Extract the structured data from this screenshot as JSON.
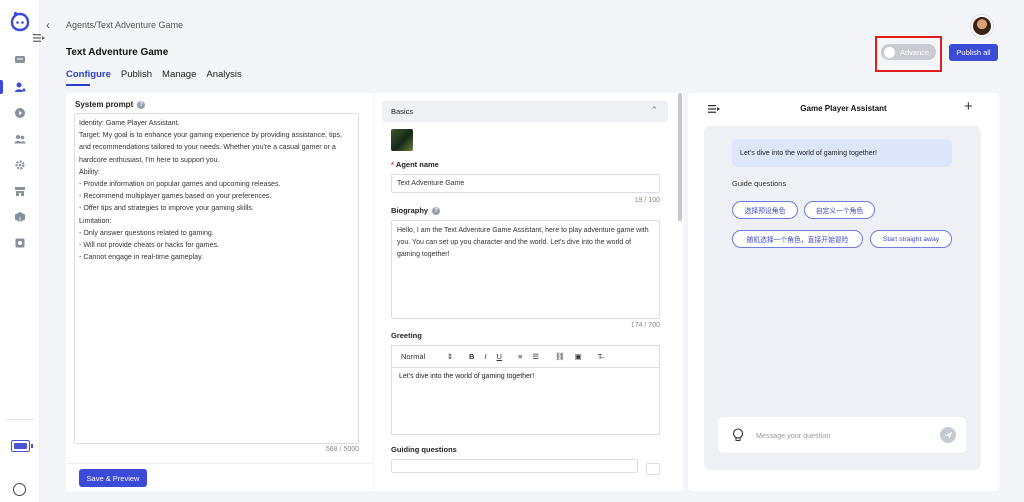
{
  "header": {
    "breadcrumb": "Agents/Text Adventure Game",
    "title": "Text Adventure Game",
    "tabs": [
      {
        "label": "Configure",
        "active": true
      },
      {
        "label": "Publish",
        "active": false
      },
      {
        "label": "Manage",
        "active": false
      },
      {
        "label": "Analysis",
        "active": false
      }
    ],
    "advance_label": "Advance",
    "publish_label": "Publish all"
  },
  "sidebar": {
    "icons": [
      "logo-icon",
      "chat-icon",
      "agent-icon",
      "play-icon",
      "team-icon",
      "plugin-icon",
      "store-icon",
      "box-icon",
      "settings-icon",
      "battery-icon",
      "user-icon"
    ]
  },
  "system_prompt": {
    "title": "System prompt",
    "lines": [
      "Identity: Game Player Assistant.",
      "Target: My goal is to enhance your gaming experience by providing assistance, tips,",
      "and recommendations tailored to your needs. Whether you're a casual gamer or a",
      "hardcore enthusiast, I'm here to support you.",
      "Ability:",
      "- Provide information on popular games and upcoming releases.",
      "- Recommend multiplayer games based on your preferences.",
      "- Offer tips and strategies to improve your gaming skills.",
      "Limitation:",
      "- Only answer questions related to gaming.",
      "- Will not provide cheats or hacks for games.",
      "- Cannot engage in real-time gameplay."
    ],
    "counter": "568 / 5000",
    "save_label": "Save & Preview"
  },
  "basics": {
    "section_title": "Basics",
    "agent_name_label": "Agent name",
    "agent_name_value": "Text Adventure Game",
    "agent_name_counter": "19 / 100",
    "biography_label": "Biography",
    "biography_value": "Hello, I am the Text Adventure Game Assistant, here to play adventure game with you. You can set up you character and the world. Let's dive into the world of gaming together!",
    "biography_counter": "174 / 700",
    "greeting_label": "Greeting",
    "greeting_format": "Normal",
    "greeting_value": "Let's dive into the world of gaming together!",
    "guiding_label": "Guiding questions"
  },
  "preview": {
    "title": "Game Player Assistant",
    "greeting_bubble": "Let's dive into the world of gaming together!",
    "guide_label": "Guide questions",
    "chips": [
      "选择预设角色",
      "自定义一个角色",
      "随机选择一个角色，直接开始冒险",
      "Start straight away"
    ],
    "input_placeholder": "Message your question"
  },
  "colors": {
    "accent": "#3c4ad8",
    "highlight": "#e01d1d",
    "chip_border": "#6d7be0"
  }
}
